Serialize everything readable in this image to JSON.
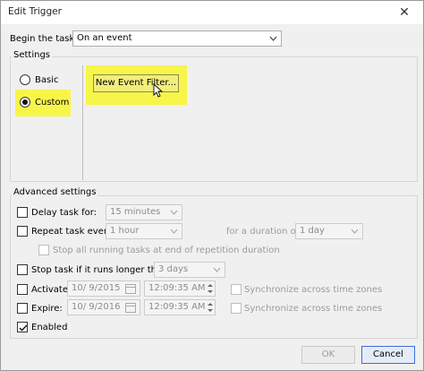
{
  "window": {
    "title": "Edit Trigger",
    "close_glyph": "✕"
  },
  "begin": {
    "label": "Begin the task:",
    "value": "On an event"
  },
  "settings": {
    "title": "Settings",
    "basic_label": "Basic",
    "custom_label": "Custom",
    "new_event_filter_label": "New Event Filter..."
  },
  "advanced": {
    "title": "Advanced settings",
    "delay": {
      "label": "Delay task for:",
      "value": "15 minutes"
    },
    "repeat": {
      "label": "Repeat task every:",
      "value": "1 hour",
      "duration_label": "for a duration of:",
      "duration_value": "1 day"
    },
    "stop_running_label": "Stop all running tasks at end of repetition duration",
    "stop_longer": {
      "label": "Stop task if it runs longer than:",
      "value": "3 days"
    },
    "activate": {
      "label": "Activate:",
      "date": "10/ 9/2015",
      "time": "12:09:35 AM",
      "sync_label": "Synchronize across time zones"
    },
    "expire": {
      "label": "Expire:",
      "date": "10/ 9/2016",
      "time": "12:09:35 AM",
      "sync_label": "Synchronize across time zones"
    },
    "enabled_label": "Enabled",
    "enabled_checked": true
  },
  "buttons": {
    "ok_label": "OK",
    "cancel_label": "Cancel"
  },
  "colors": {
    "highlight": "#f8f54a",
    "dialog_bg": "#f0f0f0",
    "focus_border": "#3c6fd8"
  }
}
